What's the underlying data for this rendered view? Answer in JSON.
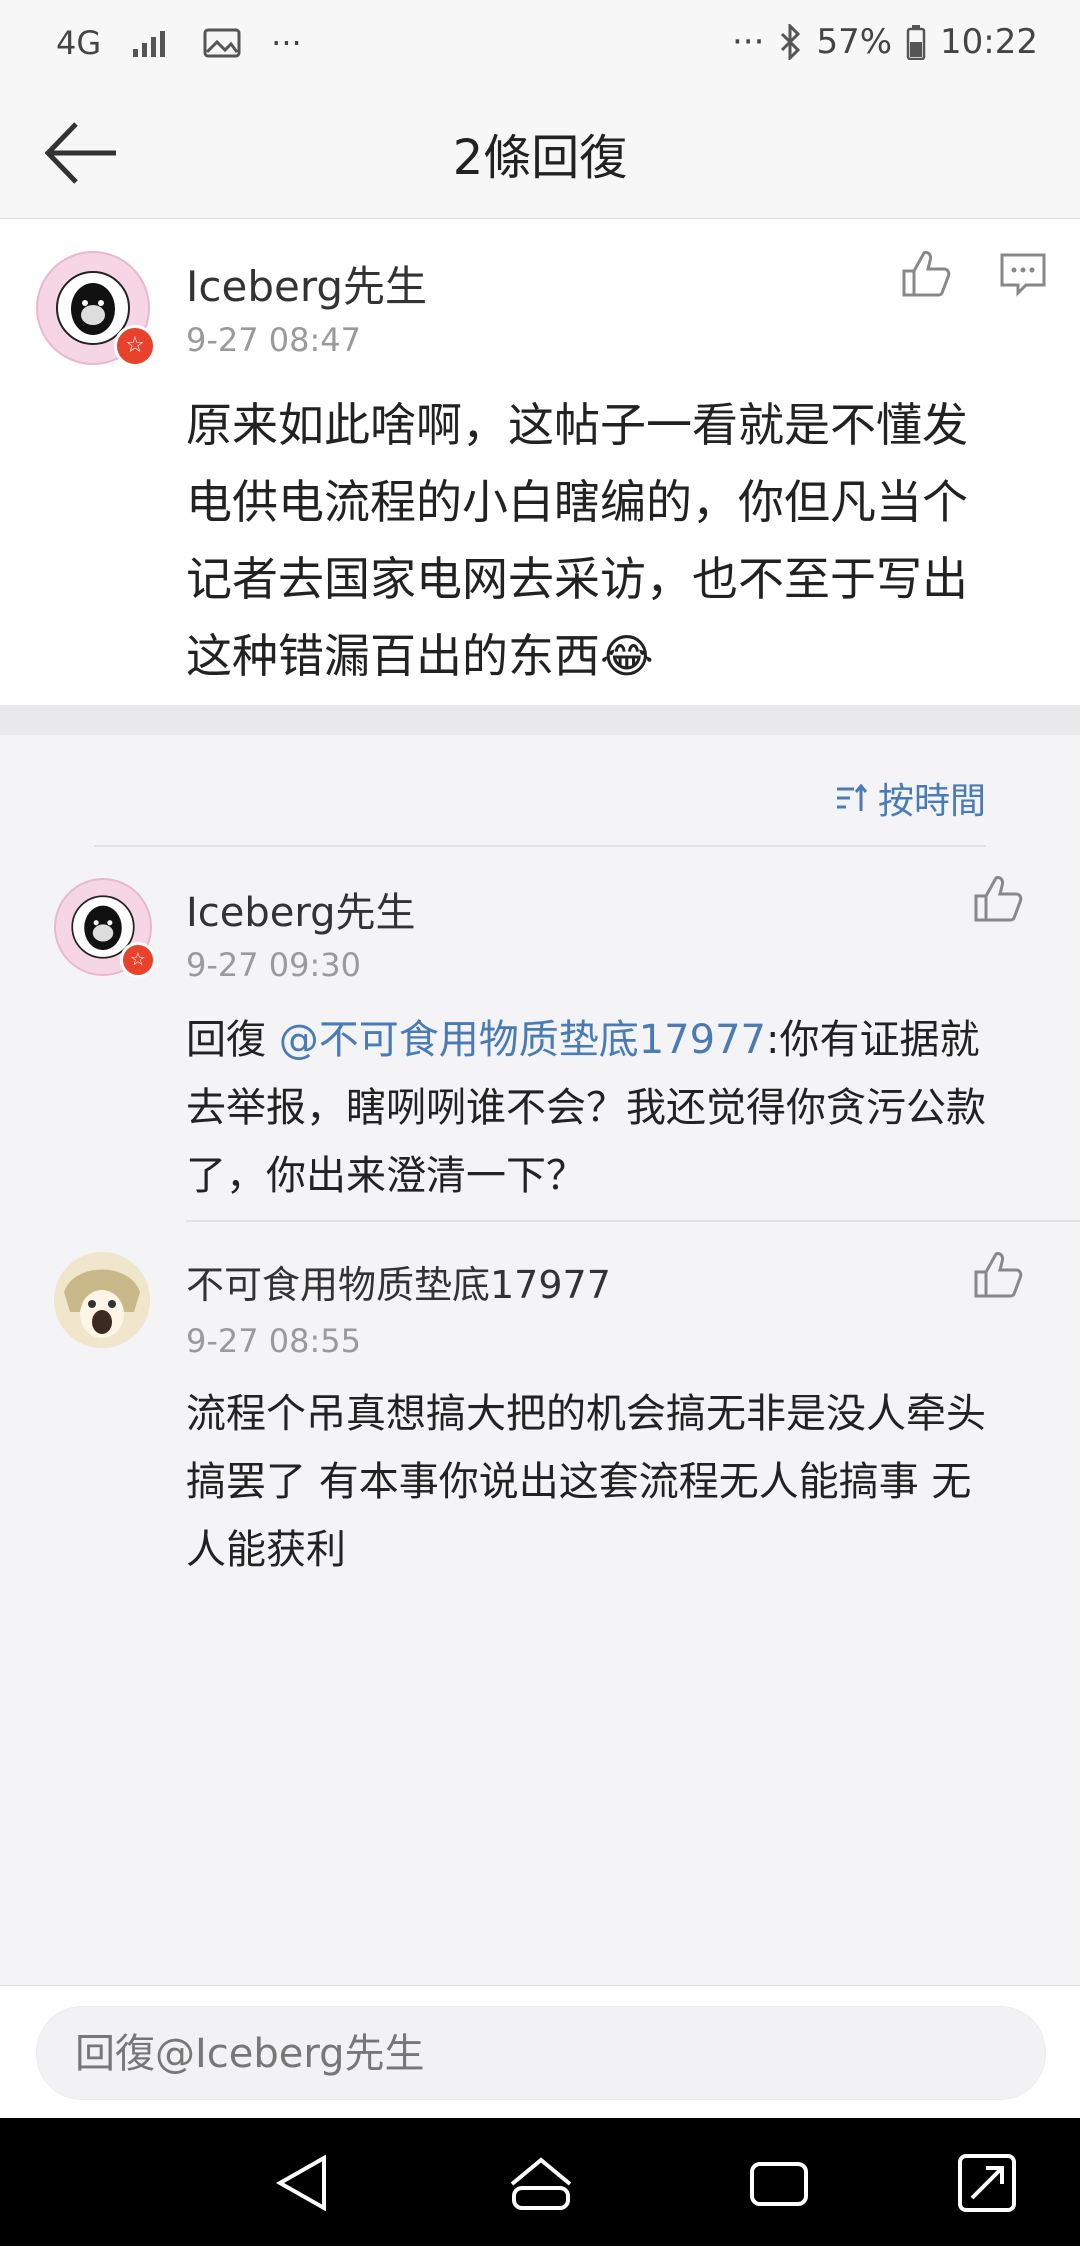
{
  "status_bar": {
    "network": "4G",
    "battery": "57%",
    "time": "10:22",
    "more": "···"
  },
  "header": {
    "title": "2條回復"
  },
  "main_comment": {
    "author": "Iceberg先生",
    "time": "9-27 08:47",
    "text_lines": [
      "原来如此啥啊，这帖子一看就是不懂发",
      "电供电流程的小白瞎编的，你但凡当个",
      "记者去国家电网去采访，也不至于写出",
      "这种错漏百出的东西"
    ],
    "emoji": "😂"
  },
  "sort": {
    "label": "按時間"
  },
  "replies": [
    {
      "author": "Iceberg先生",
      "time": "9-27 09:30",
      "prefix": "回復 ",
      "mention": "@不可食用物质垫底17977",
      "line1_rest": ":你有证据就",
      "line2": "去举报，瞎咧咧谁不会？我还觉得你贪污公款",
      "line3": "了，你出来澄清一下？"
    },
    {
      "author": "不可食用物质垫底17977",
      "time": "9-27 08:55",
      "line1": "流程个吊真想搞大把的机会搞无非是没人牵头",
      "line2": "搞罢了 有本事你说出这套流程无人能搞事 无",
      "line3": "人能获利"
    }
  ],
  "input": {
    "placeholder": "回復@Iceberg先生"
  },
  "colors": {
    "accent": "#4a7bb5",
    "background": "#f4f4f6"
  }
}
